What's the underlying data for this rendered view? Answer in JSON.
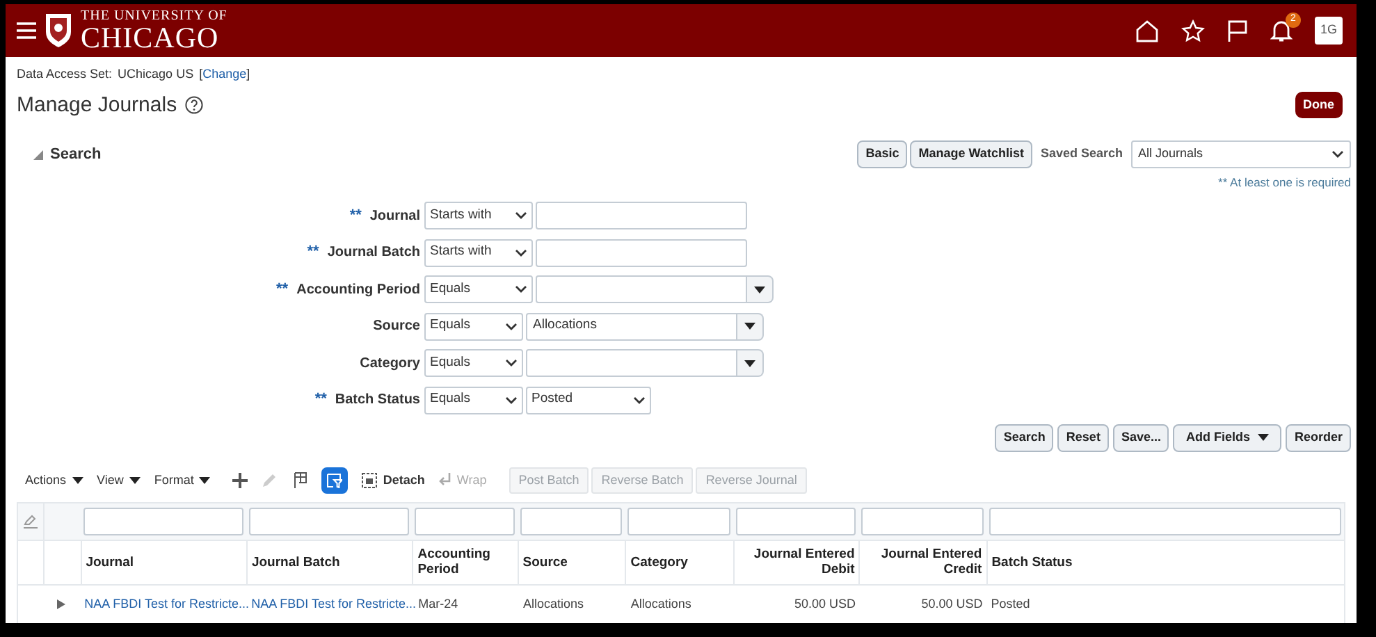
{
  "header": {
    "logo_top": "THE UNIVERSITY OF",
    "logo_bottom": "CHICAGO",
    "notifications": "2",
    "avatar": "1G"
  },
  "data_access": {
    "label": "Data Access Set:",
    "value": "UChicago US",
    "open": "[",
    "link": "Change",
    "close": "]"
  },
  "page": {
    "title": "Manage Journals",
    "done": "Done"
  },
  "search": {
    "heading": "Search",
    "expanded": true,
    "buttons": [
      "Basic",
      "Manage Watchlist"
    ],
    "saved_search_label": "Saved Search",
    "saved_search_value": "All Journals",
    "required_note": "** At least one is required"
  },
  "fields": [
    {
      "label": "Journal",
      "required": true,
      "kind": "text",
      "operator": "Starts with"
    },
    {
      "label": "Journal Batch",
      "required": true,
      "kind": "text",
      "operator": "Starts with"
    },
    {
      "label": "Accounting Period",
      "required": true,
      "kind": "lov",
      "operator": "Equals"
    },
    {
      "label": "Source",
      "required": false,
      "kind": "lov",
      "operator": "Equals",
      "value": "Allocations"
    },
    {
      "label": "Category",
      "required": false,
      "kind": "lov",
      "operator": "Equals"
    },
    {
      "label": "Batch Status",
      "required": true,
      "kind": "select",
      "operator": "Equals",
      "value": "Posted"
    }
  ],
  "required_mark": "**",
  "search_buttons": [
    {
      "label": "Search",
      "kind": "plain"
    },
    {
      "label": "Reset",
      "kind": "plain"
    },
    {
      "label": "Save...",
      "kind": "plain"
    },
    {
      "label": "Add Fields",
      "kind": "menu"
    },
    {
      "label": "Reorder",
      "kind": "plain"
    }
  ],
  "toolbar": {
    "menus": [
      "Actions",
      "View",
      "Format"
    ],
    "add_disabled": false,
    "edit_disabled": true,
    "filter_selected": true,
    "detach": "Detach",
    "wrap": "Wrap",
    "wrap_disabled": true,
    "buttons": [
      {
        "label": "Post Batch",
        "disabled": true
      },
      {
        "label": "Reverse Batch",
        "disabled": true
      },
      {
        "label": "Reverse Journal",
        "disabled": true
      }
    ]
  },
  "table": {
    "columns": [
      {
        "label": "Journal",
        "kind": "text"
      },
      {
        "label": "Journal Batch",
        "kind": "text"
      },
      {
        "label": "Accounting Period",
        "kind": "text"
      },
      {
        "label": "Source",
        "kind": "text"
      },
      {
        "label": "Category",
        "kind": "text"
      },
      {
        "label": "Journal Entered Debit",
        "kind": "amount"
      },
      {
        "label": "Journal Entered Credit",
        "kind": "amount"
      },
      {
        "label": "Batch Status",
        "kind": "text"
      }
    ],
    "rows": [
      {
        "expanded": false,
        "cells": [
          "NAA FBDI Test for Restricte...",
          "NAA FBDI Test for Restricte...",
          "Mar-24",
          "Allocations",
          "Allocations",
          "50.00 USD",
          "50.00 USD",
          "Posted"
        ],
        "links": [
          true,
          true,
          false,
          false,
          false,
          false,
          false,
          false
        ]
      }
    ]
  }
}
